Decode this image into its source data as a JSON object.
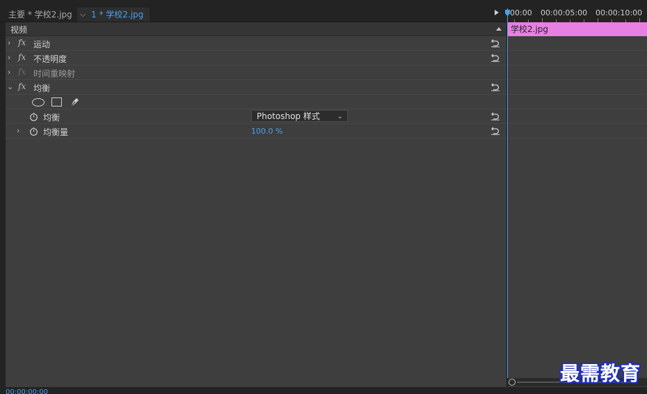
{
  "tabs": {
    "main_label": "主要 * 学校2.jpg",
    "clip_label": "1 * 学校2.jpg"
  },
  "section": {
    "label": "视频"
  },
  "effects": [
    {
      "name": "运动"
    },
    {
      "name": "不透明度"
    },
    {
      "name": "时间重映射"
    },
    {
      "name": "均衡"
    }
  ],
  "properties": {
    "equalize": {
      "label": "均衡",
      "dropdown_value": "Photoshop 样式"
    },
    "equalize_amount": {
      "label": "均衡量",
      "value": "100.0 %"
    }
  },
  "timeline": {
    "timecodes": [
      "00:00",
      "00:00:05:00",
      "00:00:10:00"
    ],
    "clip_label": "学校2.jpg",
    "clip_color": "#e87fe2",
    "playhead_color": "#4aa1ee"
  },
  "status": {
    "timecode": "00:00:00:00"
  },
  "watermark": "最需教育",
  "icons": {
    "expand": "chevron-right-icon",
    "collapse": "chevron-down-icon",
    "reset": "reset-icon",
    "stopwatch": "stopwatch-icon",
    "ellipse_mask": "ellipse-mask-icon",
    "rectangle_mask": "rectangle-mask-icon",
    "pen_mask": "pen-mask-icon"
  }
}
